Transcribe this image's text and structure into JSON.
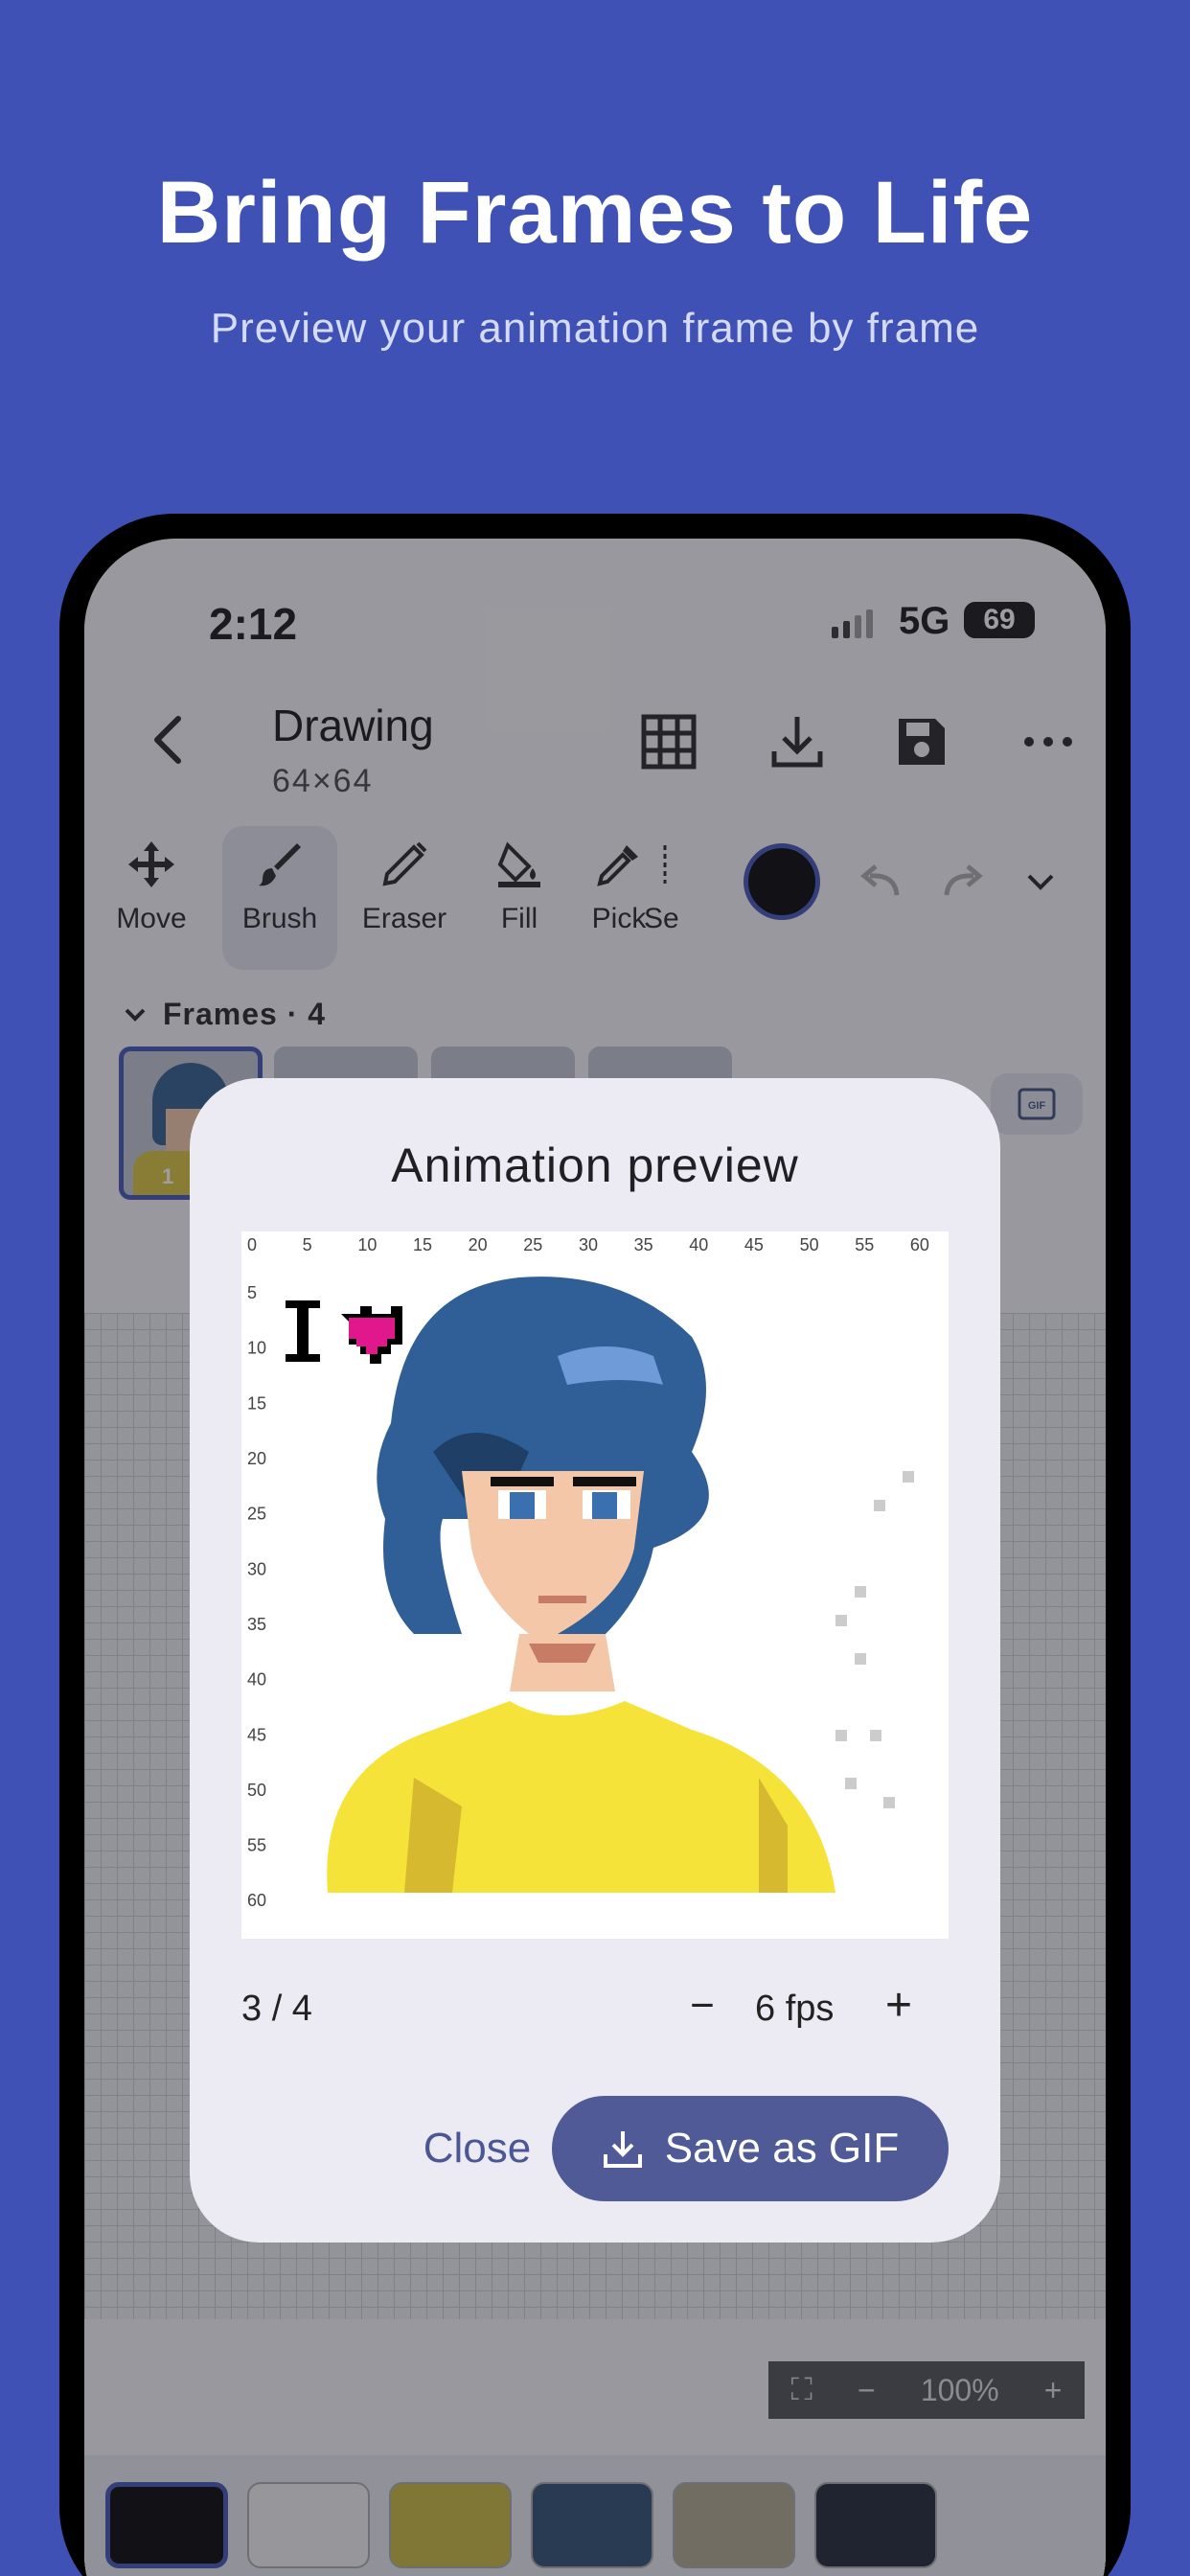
{
  "hero": {
    "title": "Bring Frames to Life",
    "subtitle": "Preview your animation frame by frame"
  },
  "status": {
    "time": "2:12",
    "network": "5G",
    "battery": "69"
  },
  "topbar": {
    "title": "Drawing",
    "size": "64×64"
  },
  "tools": [
    {
      "label": "Move"
    },
    {
      "label": "Brush"
    },
    {
      "label": "Eraser"
    },
    {
      "label": "Fill"
    },
    {
      "label": "Pick"
    },
    {
      "label": "Se"
    }
  ],
  "frames": {
    "header": "Frames · 4",
    "selected_label": "1"
  },
  "zoom": {
    "value": "100%"
  },
  "palette": [
    "#000000",
    "#f2f2f2",
    "#c9b63a",
    "#2a4a70",
    "#b0a68d",
    "#1a2230"
  ],
  "dialog": {
    "title": "Animation preview",
    "frame_counter": "3 / 4",
    "fps": "6 fps",
    "close_label": "Close",
    "save_label": "Save as GIF"
  },
  "preview_ruler": {
    "x_ticks": [
      "0",
      "5",
      "10",
      "15",
      "20",
      "25",
      "30",
      "35",
      "40",
      "45",
      "50",
      "55",
      "60"
    ],
    "y_ticks": [
      "5",
      "10",
      "15",
      "20",
      "25",
      "30",
      "35",
      "40",
      "45",
      "50",
      "55",
      "60"
    ]
  },
  "colors": {
    "accent": "#3f51b5",
    "primary_button": "#4f5a96",
    "background": "#3f51b5"
  }
}
